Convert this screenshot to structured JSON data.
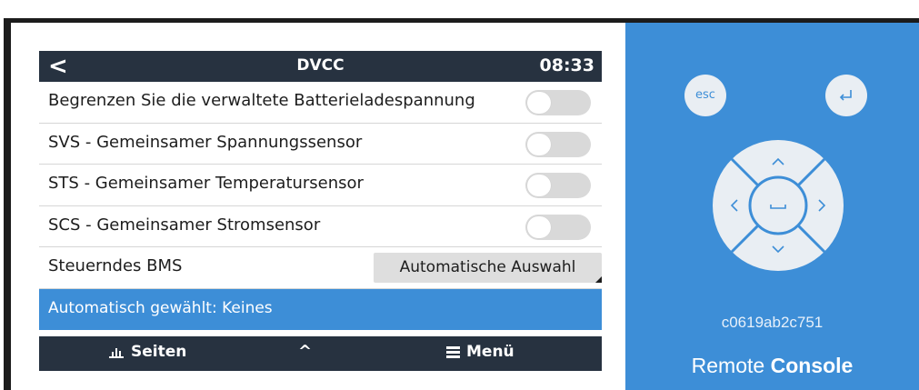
{
  "header": {
    "back_glyph": "<",
    "title": "DVCC",
    "time": "08:33"
  },
  "settings": [
    {
      "label": "Begrenzen Sie die verwaltete Batterieladespannung",
      "type": "toggle",
      "state": "off"
    },
    {
      "label": "SVS - Gemeinsamer Spannungssensor",
      "type": "toggle",
      "state": "off"
    },
    {
      "label": "STS - Gemeinsamer Temperatursensor",
      "type": "toggle",
      "state": "off"
    },
    {
      "label": "SCS - Gemeinsamer Stromsensor",
      "type": "toggle",
      "state": "off"
    }
  ],
  "bms": {
    "label": "Steuerndes BMS",
    "value": "Automatische Auswahl"
  },
  "auto_selected": {
    "label": "Automatisch gewählt: Keines"
  },
  "footer": {
    "pages_label": "Seiten",
    "up_glyph": "^",
    "menu_label": "Menü"
  },
  "remote": {
    "esc_label": "esc",
    "enter_icon": "enter-icon",
    "hostname": "c0619ab2c751",
    "brand_regular": "Remote",
    "brand_bold": "Console"
  },
  "colors": {
    "accent": "#3d8ed7",
    "titlebar": "#273240",
    "toggle_off": "#d9d9d9",
    "dpad": "#e9eef3"
  }
}
